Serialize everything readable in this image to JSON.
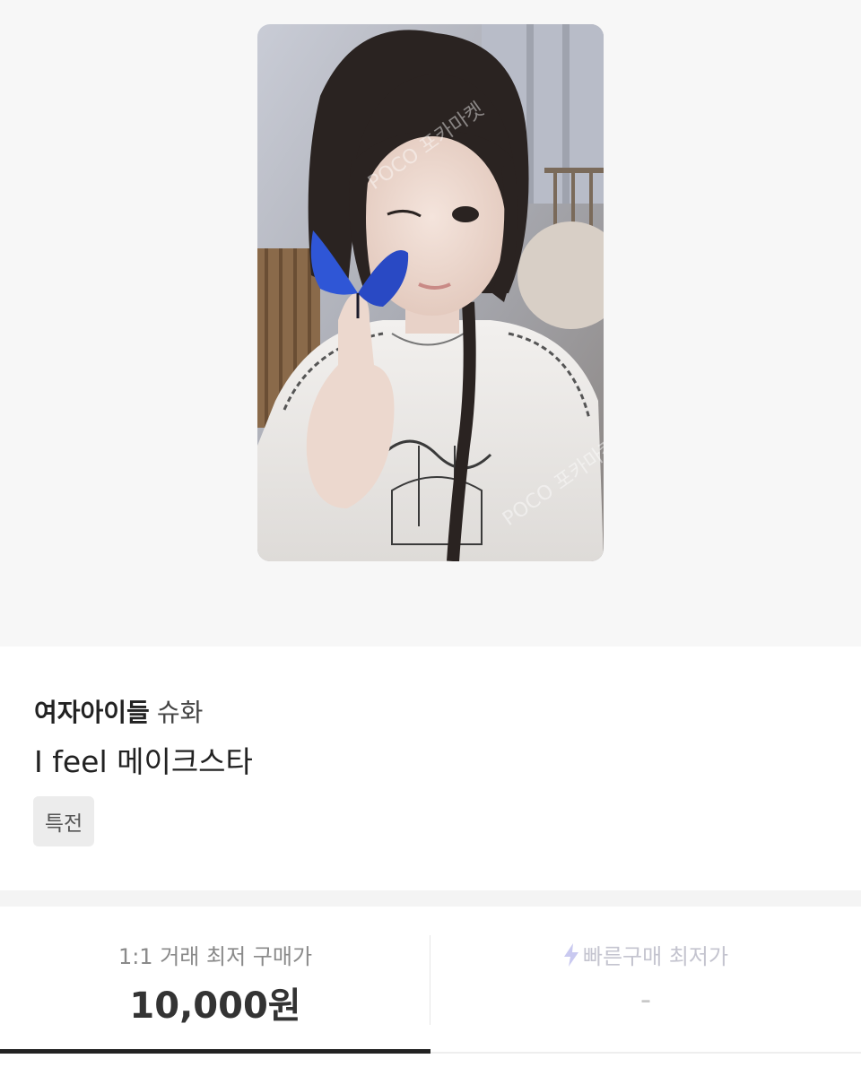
{
  "product": {
    "group": "여자아이들",
    "member": "슈화",
    "title": "I feel 메이크스타",
    "tag": "특전",
    "watermark": "POCO 포카마켓"
  },
  "prices": {
    "direct": {
      "label": "1:1 거래 최저 구매가",
      "value": "10,000원"
    },
    "quick": {
      "label": "빠른구매 최저가",
      "value": "-"
    }
  },
  "colors": {
    "hero_bg": "#f7f7f7",
    "accent_bolt": "#c9c9f0",
    "active_tab": "#222222"
  },
  "icons": {
    "quick_buy": "lightning-bolt-icon"
  }
}
